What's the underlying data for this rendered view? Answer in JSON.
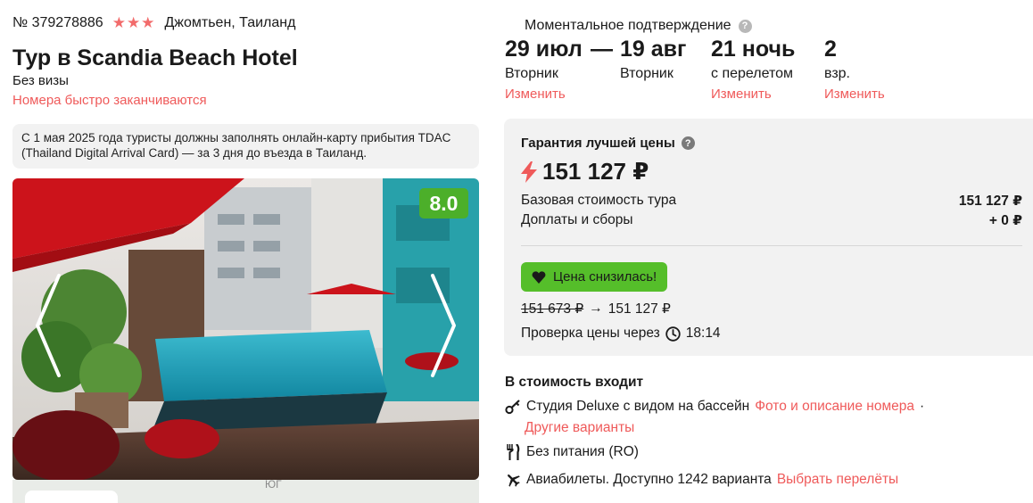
{
  "header": {
    "tour_number": "№ 379278886",
    "stars": "★★★",
    "location": "Джомтьен, Таиланд",
    "title": "Тур в Scandia Beach Hotel",
    "visa": "Без визы",
    "rooms_warning": "Номера быстро заканчиваются"
  },
  "notice": {
    "text": "С 1 мая 2025 года туристы должны заполнять онлайн-карту прибытия TDAC (Thailand Digital Arrival Card) — за 3 дня до въезда в Таиланд."
  },
  "gallery": {
    "rating": "8.0",
    "map_label": "ЮГ"
  },
  "booking": {
    "instant_confirmation": "Моментальное подтверждение",
    "help_glyph": "?",
    "date_from": "29 июл",
    "dash": "—",
    "date_to": "19 авг",
    "weekday_from": "Вторник",
    "weekday_to": "Вторник",
    "nights": "21 ночь",
    "nights_note": "с перелетом",
    "guests": "2",
    "guests_note": "взр.",
    "change_label": "Изменить"
  },
  "price": {
    "guarantee": "Гарантия лучшей цены",
    "total": "151 127 ₽",
    "base_label": "Базовая стоимость тура",
    "base_value": "151 127 ₽",
    "fees_label": "Доплаты и сборы",
    "fees_value": "+ 0 ₽",
    "drop_badge": "Цена снизилась!",
    "old_price": "151 673 ₽",
    "arrow": "→",
    "new_price": "151 127 ₽",
    "check_label": "Проверка цены через",
    "check_time": "18:14"
  },
  "included": {
    "title": "В стоимость входит",
    "room": "Студия Deluxe с видом на бассейн",
    "room_link": "Фото и описание номера",
    "dot": "·",
    "other_variants": "Другие варианты",
    "meal": "Без питания (RO)",
    "flights": "Авиабилеты. Доступно 1242 варианта",
    "flights_link": "Выбрать перелёты"
  },
  "icons": {
    "help": "question-icon",
    "bolt": "lightning-icon",
    "heart": "heart-icon",
    "clock": "clock-icon",
    "key": "key-icon",
    "fork": "fork-knife-icon",
    "plane": "plane-icon"
  },
  "colors": {
    "accent": "#ef5a5a",
    "badge_green": "#55be2a",
    "rating_green": "#4caf2a",
    "panel_gray": "#f2f2f2"
  }
}
